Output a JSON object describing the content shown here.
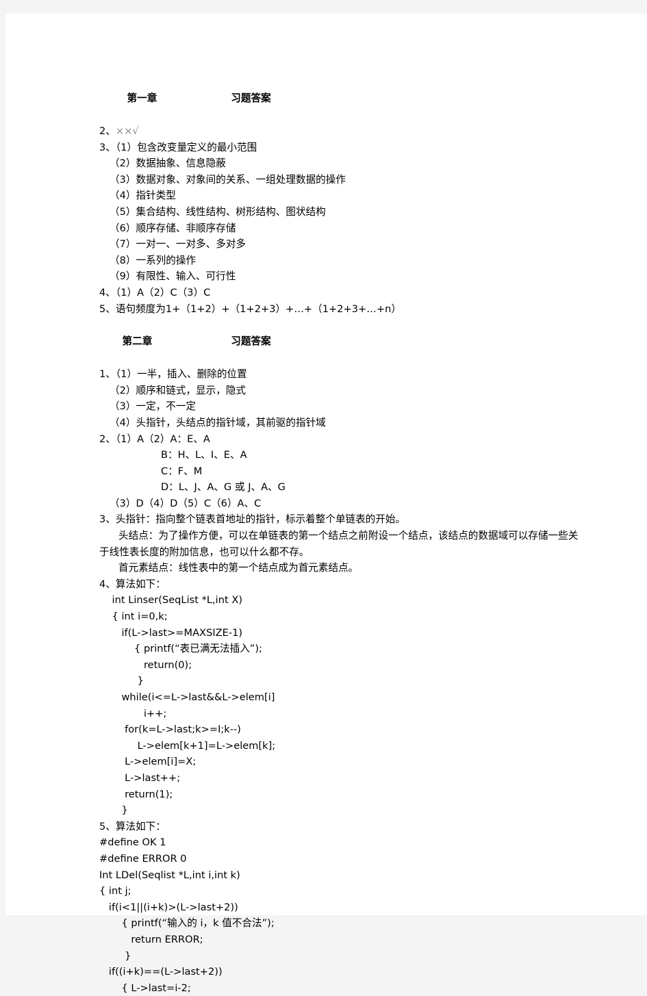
{
  "document": {
    "chapter1": {
      "heading_left": "第一章",
      "heading_right": "习题答案",
      "items": [
        {
          "prefix": "2、",
          "text": "××√",
          "style": "gray",
          "indent": 0
        },
        {
          "prefix": "3、",
          "text": "（1）包含改变量定义的最小范围",
          "indent": 0
        },
        {
          "prefix": "",
          "text": "（2）数据抽象、信息隐蔽",
          "indent": 1
        },
        {
          "prefix": "",
          "text": "（3）数据对象、对象间的关系、一组处理数据的操作",
          "indent": 1
        },
        {
          "prefix": "",
          "text": "（4）指针类型",
          "indent": 1
        },
        {
          "prefix": "",
          "text": "（5）集合结构、线性结构、树形结构、图状结构",
          "indent": 1
        },
        {
          "prefix": "",
          "text": "（6）顺序存储、非顺序存储",
          "indent": 1
        },
        {
          "prefix": "",
          "text": "（7）一对一、一对多、多对多",
          "indent": 1
        },
        {
          "prefix": "",
          "text": "（8）一系列的操作",
          "indent": 1
        },
        {
          "prefix": "",
          "text": "（9）有限性、输入、可行性",
          "indent": 1
        },
        {
          "prefix": "4、",
          "text": "（1）A（2）C（3）C",
          "indent": 0
        },
        {
          "prefix": "5、",
          "text": "语句频度为1+（1+2）+（1+2+3）+…+（1+2+3+…+n）",
          "indent": 0
        }
      ]
    },
    "chapter2": {
      "heading_left": "第二章",
      "heading_right": "习题答案",
      "items": [
        {
          "prefix": "1、",
          "text": "（1）一半，插入、删除的位置",
          "indent": 0
        },
        {
          "prefix": "",
          "text": "（2）顺序和链式，显示，隐式",
          "indent": 1
        },
        {
          "prefix": "",
          "text": "（3）一定，不一定",
          "indent": 1
        },
        {
          "prefix": "",
          "text": "（4）头指针，头结点的指针域，其前驱的指针域",
          "indent": 1
        },
        {
          "prefix": "2、",
          "text": "（1）A（2）A：E、A",
          "indent": 0
        },
        {
          "prefix": "",
          "text": "B：H、L、I、E、A",
          "indent": 6
        },
        {
          "prefix": "",
          "text": "C：F、M",
          "indent": 6
        },
        {
          "prefix": "",
          "text": "D：L、J、A、G 或 J、A、G",
          "indent": 6
        },
        {
          "prefix": "",
          "text": "（3）D（4）D（5）C（6）A、C",
          "indent": 1
        },
        {
          "prefix": "3、",
          "text": "头指针：指向整个链表首地址的指针，标示着整个单链表的开始。",
          "indent": 0
        }
      ],
      "paragraphs": [
        "头结点：为了操作方便，可以在单链表的第一个结点之前附设一个结点，该结点的数据域可以存储一些关于线性表长度的附加信息，也可以什么都不存。",
        "首元素结点：线性表中的第一个结点成为首元素结点。"
      ],
      "algo4_label": "4、算法如下：",
      "algo4_code": [
        "    int Linser(SeqList *L,int X)",
        "    { int i=0,k;",
        "       if(L->last>=MAXSIZE-1)",
        "           { printf(“表已满无法插入”);",
        "              return(0);",
        "            }",
        "       while(i<=L->last&&L->elem[i]",
        "              i++;",
        "        for(k=L->last;k>=I;k--)",
        "            L->elem[k+1]=L->elem[k];",
        "        L->elem[i]=X;",
        "        L->last++;",
        "        return(1);",
        "       }"
      ],
      "algo5_label": "5、算法如下：",
      "algo5_code": [
        "#define OK 1",
        "#define ERROR 0",
        "Int LDel(Seqlist *L,int i,int k)",
        "{ int j;",
        "   if(i<1||(i+k)>(L->last+2))",
        "       { printf(“输入的 i，k 值不合法”);",
        "          return ERROR;",
        "        }",
        "   if((i+k)==(L->last+2))",
        "       { L->last=i-2;"
      ]
    }
  }
}
